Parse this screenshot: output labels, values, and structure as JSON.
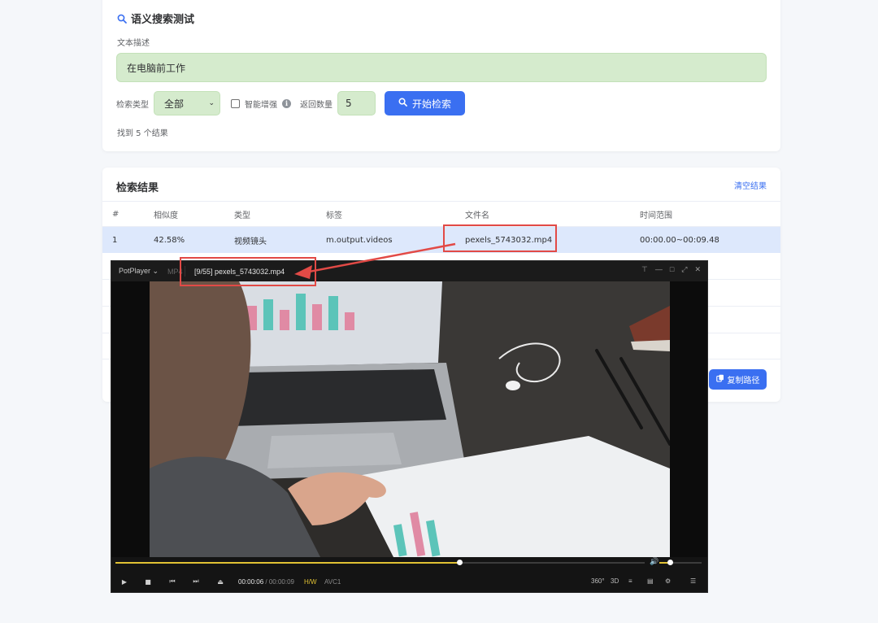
{
  "search": {
    "title": "语义搜索测试",
    "text_label": "文本描述",
    "text_value": "在电脑前工作",
    "type_label": "检索类型",
    "type_selected": "全部",
    "enhance_label": "智能增强",
    "enhance_checked": false,
    "count_label": "返回数量",
    "count_value": "5",
    "search_button": "开始检索",
    "result_summary": "找到 5 个结果"
  },
  "results": {
    "title": "检索结果",
    "clear_label": "清空结果",
    "columns": [
      "#",
      "相似度",
      "类型",
      "标签",
      "文件名",
      "时间范围"
    ],
    "rows": [
      {
        "index": "1",
        "similarity": "42.58%",
        "type": "视频镜头",
        "tags": "m.output.videos",
        "filename": "pexels_5743032.mp4",
        "time_range": "00:00.00~00:09.48"
      }
    ],
    "copy_path_label": "复制路径"
  },
  "player": {
    "app_name": "PotPlayer",
    "format_tag": "MP4",
    "playlist_title": "[9/55] pexels_5743032.mp4",
    "time_current": "00:00:06",
    "time_separator": "/",
    "time_total": "00:00:09",
    "hw_label": "H/W",
    "codec_label": "AVC1",
    "progress_fraction": 0.65,
    "volume_fraction": 0.25,
    "right_controls": [
      "360°",
      "3D"
    ]
  },
  "colors": {
    "accent": "#3a6ff1",
    "input_green": "#d5ebcd",
    "highlight_row": "#dde8fc",
    "annotation_red": "#e24a46",
    "player_accent": "#e0c133"
  }
}
